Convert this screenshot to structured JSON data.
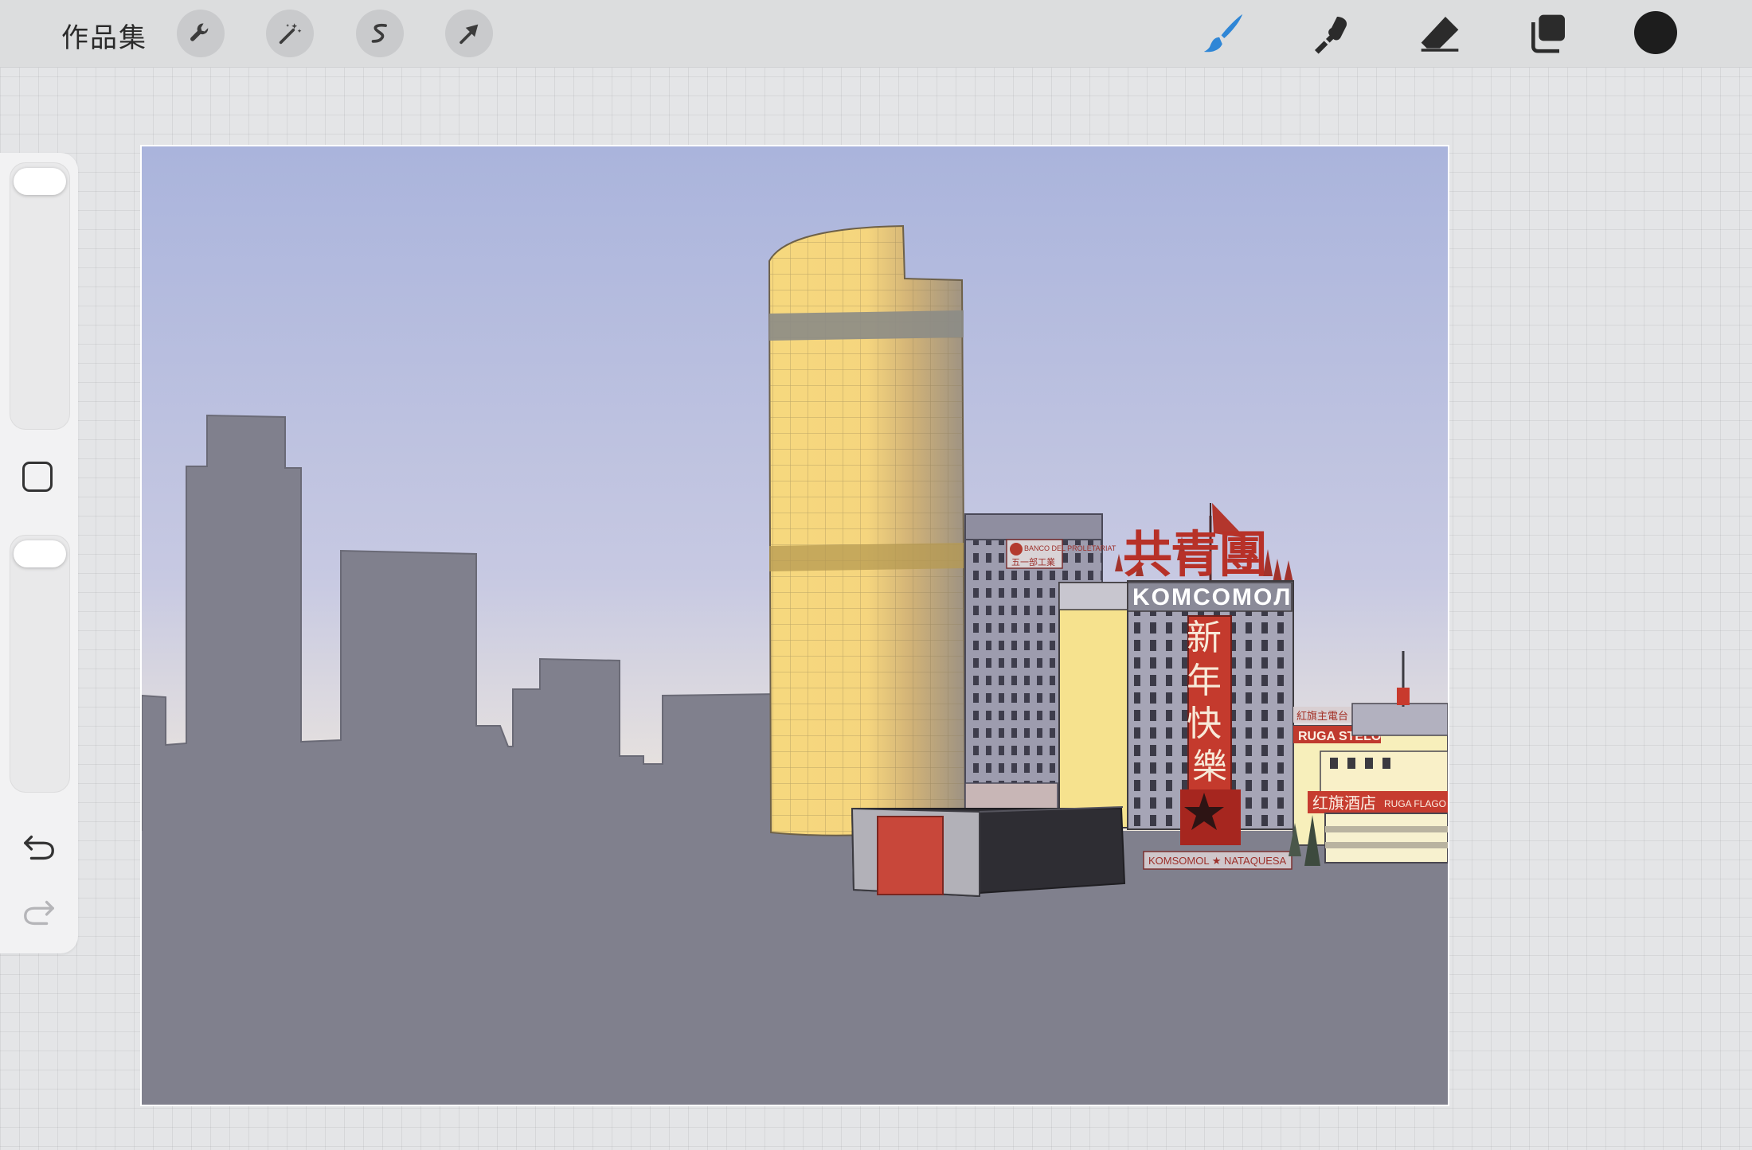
{
  "toolbar": {
    "gallery_label": "作品集",
    "left_tools": [
      {
        "name": "wrench-icon",
        "label": "actions"
      },
      {
        "name": "magic-wand-icon",
        "label": "adjustments"
      },
      {
        "name": "selection-s-icon",
        "label": "selection"
      },
      {
        "name": "transform-arrow-icon",
        "label": "transform"
      }
    ],
    "right_tools": [
      {
        "name": "brush-icon",
        "active": true
      },
      {
        "name": "smudge-icon",
        "active": false
      },
      {
        "name": "eraser-icon",
        "active": false
      },
      {
        "name": "layers-icon",
        "active": false
      }
    ],
    "active_color": "#1d1d1d",
    "active_tool_color": "#2f86d6"
  },
  "sidebar": {
    "brush_size_level": 1.0,
    "opacity_level": 1.0,
    "icons": [
      "square-modify-icon",
      "undo-icon",
      "redo-icon"
    ],
    "redo_enabled": false
  },
  "artwork": {
    "sky_top": "#aab4dc",
    "sky_mid": "#c7c9e2",
    "sky_bottom": "#fbf1dc",
    "ground": "#80808d",
    "signs": {
      "banner_vertical": "新年快樂",
      "roof_sign": "共青團",
      "building_name": "KOMCOMOЛ",
      "bank_sign_1": "BANCO DEL PROLETARIAT",
      "bank_sign_2": "五一部工業",
      "street_sign_1": "RUGA STELO",
      "street_sign_2": "红旗酒店",
      "street_sign_3": "RUGA FLAGO",
      "street_sign_4": "紅旗主電台",
      "base_sign": "KOMSOMOL ★ NATAQUESA"
    }
  }
}
